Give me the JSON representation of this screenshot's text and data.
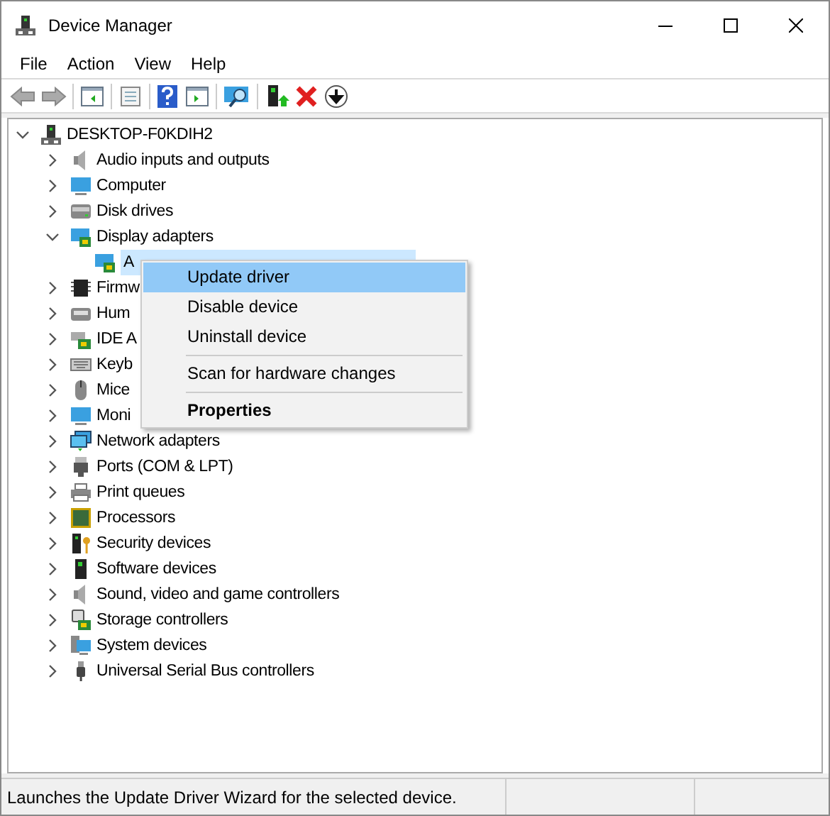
{
  "window": {
    "title": "Device Manager"
  },
  "menu_bar": [
    "File",
    "Action",
    "View",
    "Help"
  ],
  "tree": {
    "label": "DESKTOP-F0KDIH2",
    "expanded": true,
    "selected": false,
    "children": [
      {
        "label": "Audio inputs and outputs",
        "expanded": false,
        "selected": false
      },
      {
        "label": "Computer",
        "expanded": false,
        "selected": false
      },
      {
        "label": "Disk drives",
        "expanded": false,
        "selected": false
      },
      {
        "label": "Display adapters",
        "expanded": true,
        "selected": false,
        "children": [
          {
            "label": "A",
            "selected": true
          }
        ]
      },
      {
        "label": "Firmw",
        "expanded": false,
        "selected": false
      },
      {
        "label": "Hum",
        "expanded": false,
        "selected": false
      },
      {
        "label": "IDE A",
        "expanded": false,
        "selected": false
      },
      {
        "label": "Keyb",
        "expanded": false,
        "selected": false
      },
      {
        "label": "Mice",
        "expanded": false,
        "selected": false
      },
      {
        "label": "Moni",
        "expanded": false,
        "selected": false
      },
      {
        "label": "Network adapters",
        "expanded": false,
        "selected": false
      },
      {
        "label": "Ports (COM & LPT)",
        "expanded": false,
        "selected": false
      },
      {
        "label": "Print queues",
        "expanded": false,
        "selected": false
      },
      {
        "label": "Processors",
        "expanded": false,
        "selected": false
      },
      {
        "label": "Security devices",
        "expanded": false,
        "selected": false
      },
      {
        "label": "Software devices",
        "expanded": false,
        "selected": false
      },
      {
        "label": "Sound, video and game controllers",
        "expanded": false,
        "selected": false
      },
      {
        "label": "Storage controllers",
        "expanded": false,
        "selected": false
      },
      {
        "label": "System devices",
        "expanded": false,
        "selected": false
      },
      {
        "label": "Universal Serial Bus controllers",
        "expanded": false,
        "selected": false
      }
    ]
  },
  "context_menu": [
    {
      "kind": "item",
      "label": "Update driver",
      "selected": true,
      "default": false
    },
    {
      "kind": "item",
      "label": "Disable device",
      "selected": false,
      "default": false
    },
    {
      "kind": "item",
      "label": "Uninstall device",
      "selected": false,
      "default": false
    },
    {
      "kind": "separator"
    },
    {
      "kind": "item",
      "label": "Scan for hardware changes",
      "selected": false,
      "default": false
    },
    {
      "kind": "separator"
    },
    {
      "kind": "item",
      "label": "Properties",
      "selected": false,
      "default": true
    }
  ],
  "status_bar": "Launches the Update Driver Wizard for the selected device."
}
